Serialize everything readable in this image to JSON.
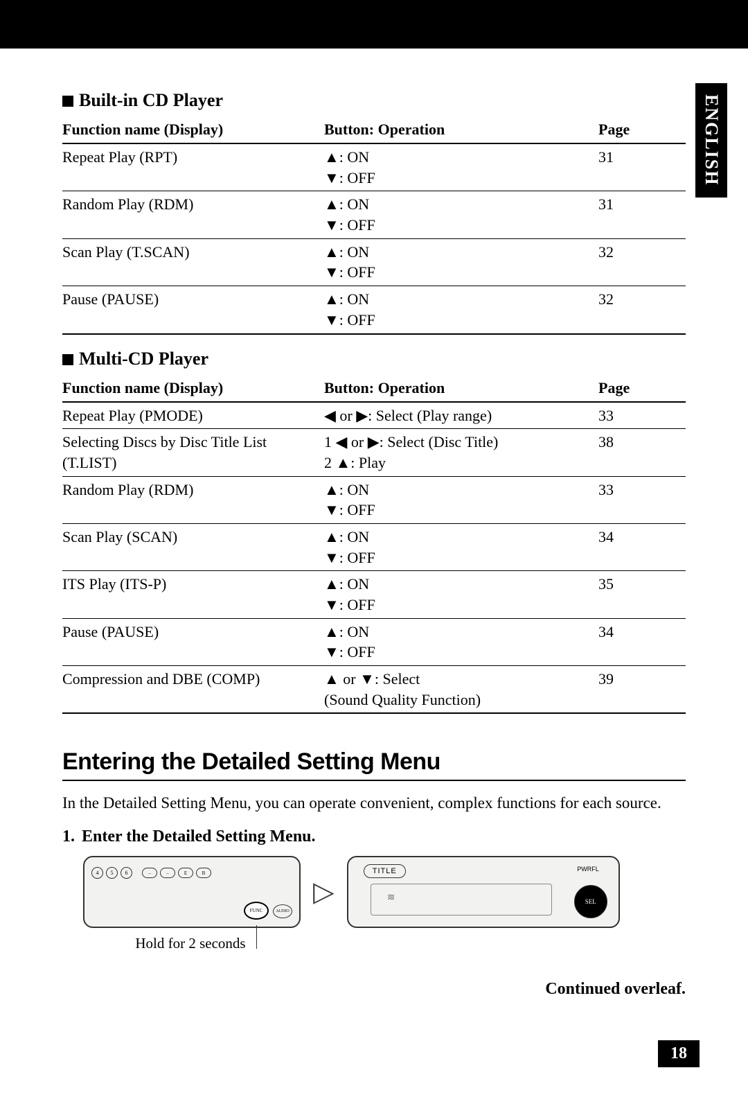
{
  "language_tab": "ENGLISH",
  "section1": {
    "title": "Built-in CD Player",
    "headers": [
      "Function name (Display)",
      "Button: Operation",
      "Page"
    ],
    "rows": [
      {
        "fn": "Repeat Play (RPT)",
        "ops": [
          "▲: ON",
          "▼: OFF"
        ],
        "page": "31"
      },
      {
        "fn": "Random Play (RDM)",
        "ops": [
          "▲: ON",
          "▼: OFF"
        ],
        "page": "31"
      },
      {
        "fn": "Scan Play (T.SCAN)",
        "ops": [
          "▲: ON",
          "▼: OFF"
        ],
        "page": "32"
      },
      {
        "fn": "Pause (PAUSE)",
        "ops": [
          "▲: ON",
          "▼: OFF"
        ],
        "page": "32"
      }
    ]
  },
  "section2": {
    "title": "Multi-CD Player",
    "headers": [
      "Function name (Display)",
      "Button: Operation",
      "Page"
    ],
    "rows": [
      {
        "fn": "Repeat Play (PMODE)",
        "ops": [
          "◀ or ▶: Select (Play range)"
        ],
        "page": "33"
      },
      {
        "fn": "Selecting Discs by Disc Title List\n(T.LIST)",
        "ops": [
          "1 ◀ or ▶: Select (Disc Title)",
          "2 ▲: Play"
        ],
        "page": "38"
      },
      {
        "fn": "Random Play (RDM)",
        "ops": [
          "▲: ON",
          "▼: OFF"
        ],
        "page": "33"
      },
      {
        "fn": "Scan Play (SCAN)",
        "ops": [
          "▲: ON",
          "▼: OFF"
        ],
        "page": "34"
      },
      {
        "fn": "ITS Play (ITS-P)",
        "ops": [
          "▲: ON",
          "▼: OFF"
        ],
        "page": "35"
      },
      {
        "fn": "Pause (PAUSE)",
        "ops": [
          "▲: ON",
          "▼: OFF"
        ],
        "page": "34"
      },
      {
        "fn": "Compression and DBE (COMP)",
        "ops": [
          "▲ or ▼: Select",
          "(Sound Quality Function)"
        ],
        "page": "39"
      }
    ]
  },
  "entering": {
    "heading": "Entering the Detailed Setting Menu",
    "intro": "In the Detailed Setting Menu, you can operate convenient, complex functions for each source.",
    "step1_num": "1.",
    "step1_text": "Enter the Detailed Setting Menu.",
    "caption": "Hold for 2 seconds",
    "diag_title": "TITLE",
    "diag_pwr": "PWRFL",
    "diag_sel": "SEL",
    "diag_func": "FUNC",
    "diag_audio": "AUDIO"
  },
  "overleaf": "Continued overleaf.",
  "page_number": "18"
}
